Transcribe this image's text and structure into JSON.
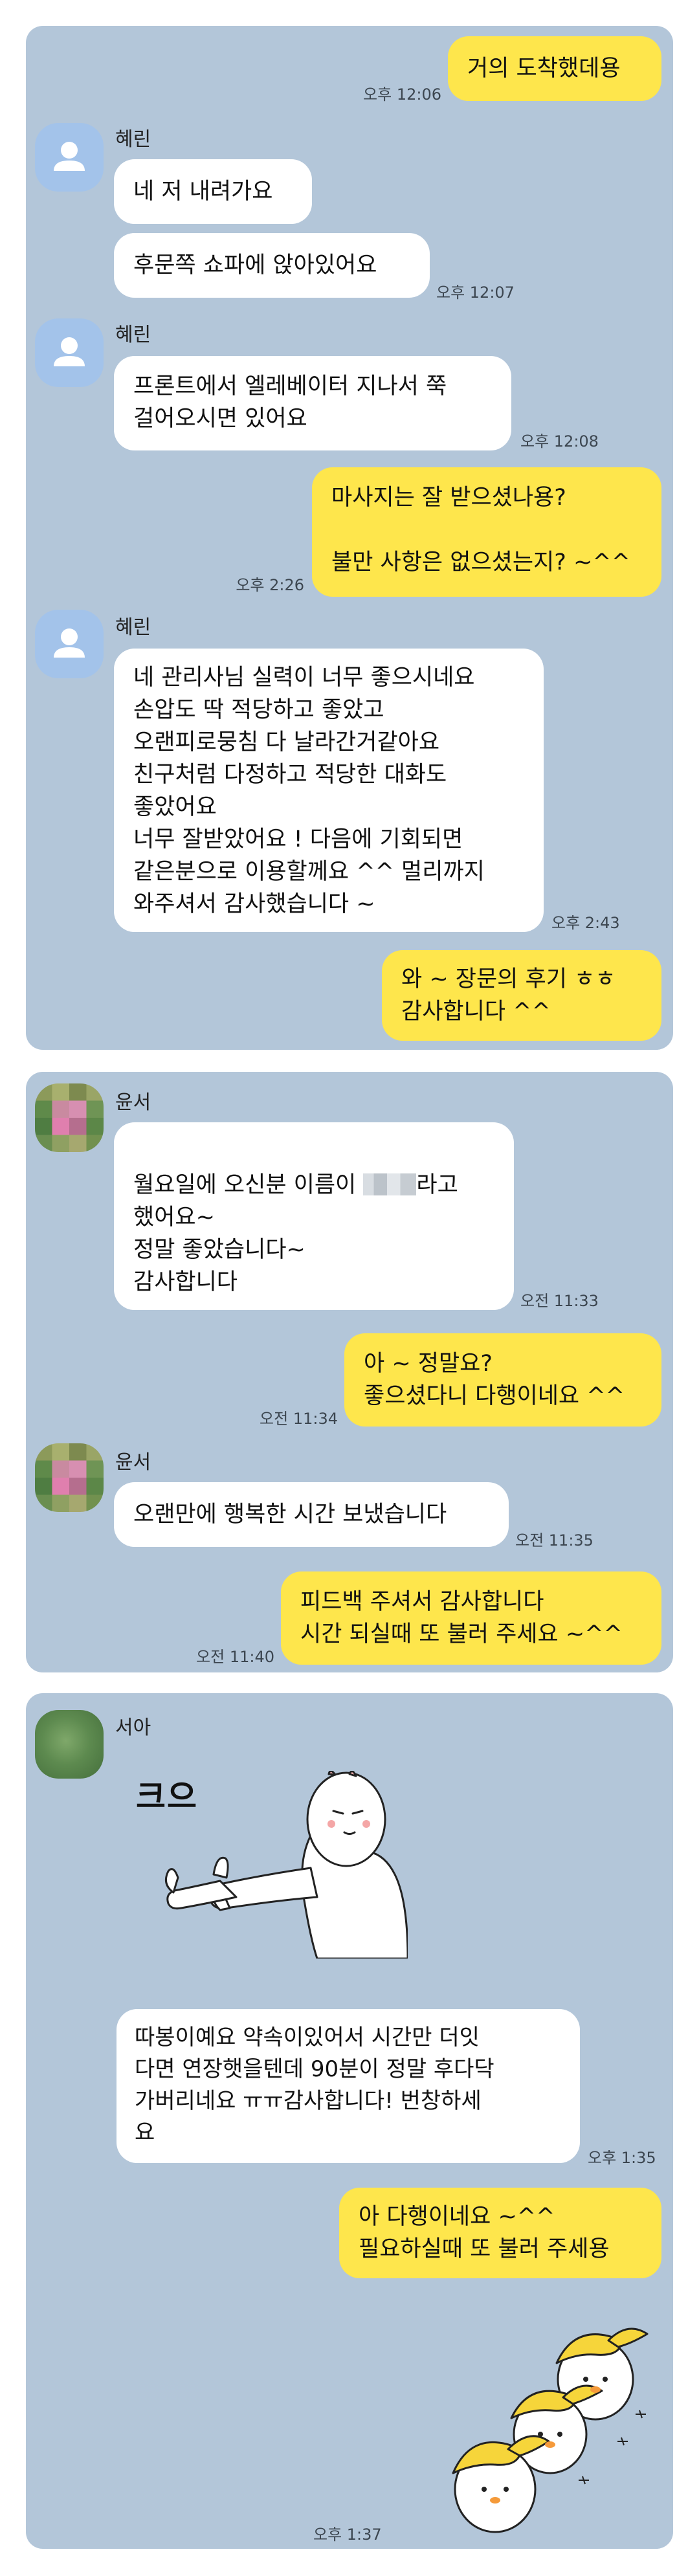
{
  "panels": [
    {
      "messages": [
        {
          "text": "거의 도착했데용",
          "time": "오후 12:06"
        },
        {
          "name": "혜린"
        },
        {
          "text": "네 저 내려가요"
        },
        {
          "text": "후문쪽 쇼파에 앉아있어요",
          "time": "오후 12:07"
        },
        {
          "name": "혜린"
        },
        {
          "text": "프론트에서 엘레베이터 지나서 쭉\n걸어오시면 있어요",
          "time": "오후 12:08"
        },
        {
          "text": "마사지는 잘 받으셨나용?\n\n불만 사항은 없으셨는지? ~^^",
          "time": "오후 2:26"
        },
        {
          "name": "혜린"
        },
        {
          "text": "네 관리사님 실력이 너무 좋으시네요\n손압도 딱 적당하고 좋았고\n오랜피로뭉침 다 날라간거같아요\n친구처럼 다정하고 적당한 대화도\n좋았어요\n너무 잘받았어요 ! 다음에 기회되면\n같은분으로 이용할께요 ^^ 멀리까지\n와주셔서 감사했습니다 ~",
          "time": "오후 2:43"
        },
        {
          "text": "와 ~ 장문의 후기 ㅎㅎ\n감사합니다 ^^"
        }
      ]
    },
    {
      "messages": [
        {
          "name": "윤서"
        },
        {
          "text_a": "월요일에 오신분 이름이 ",
          "text_b": "라고\n했어요~\n정말 좋았습니다~\n감사합니다",
          "time": "오전 11:33"
        },
        {
          "text": "아 ~ 정말요?\n좋으셨다니 다행이네요 ^^",
          "time": "오전 11:34"
        },
        {
          "name": "윤서"
        },
        {
          "text": "오랜만에 행복한 시간 보냈습니다",
          "time": "오전 11:35"
        },
        {
          "text": "피드백 주셔서 감사합니다\n시간 되실때 또 불러 주세요 ~^^",
          "time": "오전 11:40"
        }
      ]
    },
    {
      "messages": [
        {
          "name": "서아"
        },
        {
          "sticker_text": "크으"
        },
        {
          "text": "따봉이예요 약속이있어서 시간만 더잇\n다면 연장햇을텐데 90분이 정말 후다닥\n가버리네요 ㅠㅠ감사합니다! 번창하세\n요",
          "time": "오후 1:35"
        },
        {
          "text": "아 다행이네요 ~^^\n필요하실때 또 불러 주세용"
        },
        {
          "time": "오후 1:37"
        }
      ]
    }
  ],
  "colors": {
    "chat_background": "#b3c6d9",
    "incoming_bubble": "#ffffff",
    "outgoing_bubble": "#fee64c",
    "default_avatar": "#a3c3ea"
  },
  "icons": [
    "person-icon",
    "thumbs-up-sticker",
    "duck-sticker"
  ]
}
